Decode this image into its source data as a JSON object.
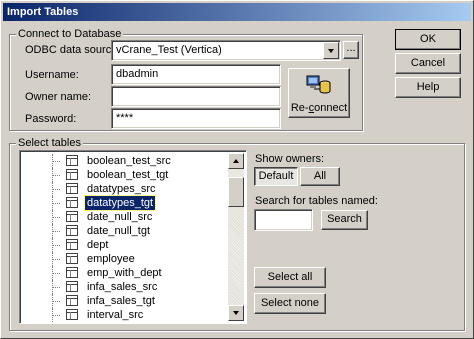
{
  "window": {
    "title": "Import Tables"
  },
  "connect": {
    "group_title": "Connect to Database",
    "odbc_label": "ODBC data source:",
    "odbc_value": "vCrane_Test (Vertica)",
    "browse_label": "...",
    "username_label": "Username:",
    "username_value": "dbadmin",
    "owner_label": "Owner name:",
    "owner_value": "",
    "password_label": "Password:",
    "password_value": "****",
    "reconnect_pre": "Re-",
    "reconnect_mnemonic": "c",
    "reconnect_post": "onnect"
  },
  "select": {
    "group_title": "Select tables",
    "tables": [
      {
        "name": "boolean_test_src",
        "selected": false
      },
      {
        "name": "boolean_test_tgt",
        "selected": false
      },
      {
        "name": "datatypes_src",
        "selected": false
      },
      {
        "name": "datatypes_tgt",
        "selected": true
      },
      {
        "name": "date_null_src",
        "selected": false
      },
      {
        "name": "date_null_tgt",
        "selected": false
      },
      {
        "name": "dept",
        "selected": false
      },
      {
        "name": "employee",
        "selected": false
      },
      {
        "name": "emp_with_dept",
        "selected": false
      },
      {
        "name": "infa_sales_src",
        "selected": false
      },
      {
        "name": "infa_sales_tgt",
        "selected": false
      },
      {
        "name": "interval_src",
        "selected": false
      }
    ],
    "show_owners_label": "Show owners:",
    "default_label": "Default",
    "all_label": "All",
    "search_label": "Search for tables named:",
    "search_value": "",
    "search_button": "Search",
    "select_all": "Select all",
    "select_none": "Select none"
  },
  "buttons": {
    "ok": "OK",
    "cancel": "Cancel",
    "help": "Help"
  },
  "colors": {
    "dialog_bg": "#d4d0c8",
    "title_start": "#0a246a",
    "title_end": "#a6caf0",
    "selection": "#0a246a"
  }
}
